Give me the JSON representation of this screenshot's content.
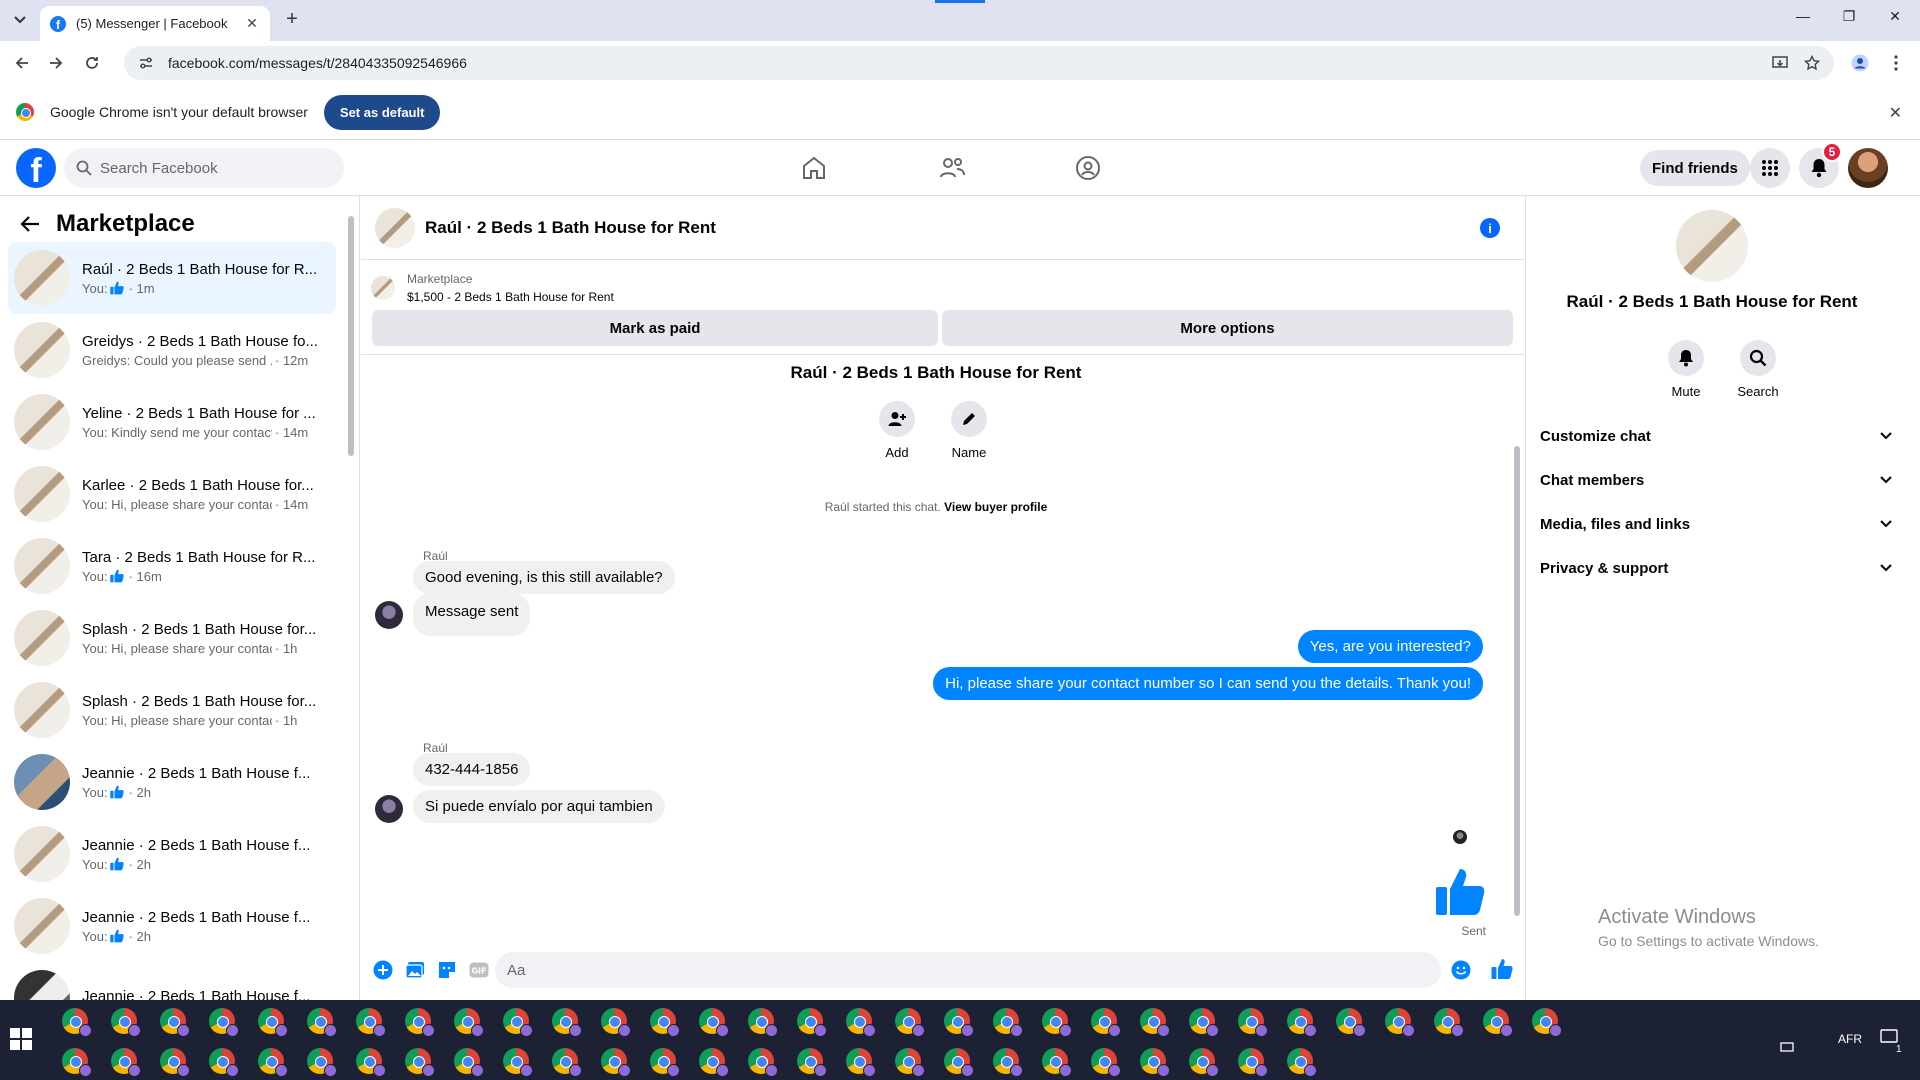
{
  "browser": {
    "tab_title": "(5) Messenger | Facebook",
    "url": "facebook.com/messages/t/28404335092546966",
    "infobar_message": "Google Chrome isn't your default browser",
    "infobar_button": "Set as default"
  },
  "facebook": {
    "search_placeholder": "Search Facebook",
    "find_friends": "Find friends",
    "notification_count": "5"
  },
  "sidebar": {
    "title": "Marketplace",
    "conversations": [
      {
        "name": "Raúl · 2 Beds 1 Bath House for R...",
        "prefix": "You:",
        "like": true,
        "preview": "",
        "time": "· 1m",
        "active": true
      },
      {
        "name": "Greidys · 2 Beds 1 Bath House fo...",
        "prefix": "",
        "like": false,
        "preview": "Greidys: Could you please send ...",
        "time": "· 12m",
        "active": false
      },
      {
        "name": "Yeline · 2 Beds 1 Bath House for ...",
        "prefix": "",
        "like": false,
        "preview": "You: Kindly send me your contact...",
        "time": "· 14m",
        "active": false
      },
      {
        "name": "Karlee · 2 Beds 1 Bath House for...",
        "prefix": "",
        "like": false,
        "preview": "You: Hi, please share your contac...",
        "time": "· 14m",
        "active": false
      },
      {
        "name": "Tara · 2 Beds 1 Bath House for R...",
        "prefix": "You:",
        "like": true,
        "preview": "",
        "time": "· 16m",
        "active": false
      },
      {
        "name": "Splash · 2 Beds 1 Bath House for...",
        "prefix": "",
        "like": false,
        "preview": "You: Hi, please share your contact ...",
        "time": "· 1h",
        "active": false
      },
      {
        "name": "Splash · 2 Beds 1 Bath House for...",
        "prefix": "",
        "like": false,
        "preview": "You: Hi, please share your contact ...",
        "time": "· 1h",
        "active": false
      },
      {
        "name": "Jeannie · 2 Beds 1 Bath House f...",
        "prefix": "You:",
        "like": true,
        "preview": "",
        "time": "· 2h",
        "active": false
      },
      {
        "name": "Jeannie · 2 Beds 1 Bath House f...",
        "prefix": "You:",
        "like": true,
        "preview": "",
        "time": "· 2h",
        "active": false
      },
      {
        "name": "Jeannie · 2 Beds 1 Bath House f...",
        "prefix": "You:",
        "like": true,
        "preview": "",
        "time": "· 2h",
        "active": false
      },
      {
        "name": "Jeannie · 2 Beds 1 Bath House f...",
        "prefix": "",
        "like": false,
        "preview": "",
        "time": "",
        "active": false
      }
    ]
  },
  "chat": {
    "title": "Raúl · 2 Beds 1 Bath House for Rent",
    "listing_source": "Marketplace",
    "listing_line": "$1,500 - 2 Beds 1 Bath House for Rent",
    "mark_paid": "Mark as paid",
    "more_options": "More options",
    "thread_title": "Raúl · 2 Beds 1 Bath House for Rent",
    "add_label": "Add",
    "name_label": "Name",
    "started_text": "Raúl started this chat.",
    "buyer_profile_link": "View buyer profile",
    "sender_name": "Raúl",
    "msg1": "Good evening, is this still available?",
    "msg2": "Message sent",
    "out1": "Yes, are you interested?",
    "out2": "Hi, please share your contact number so I can send you the details. Thank you!",
    "sender_name2": "Raúl",
    "msg3": "432-444-1856",
    "msg4": "Si puede envíalo por aqui tambien",
    "sent_label": "Sent",
    "composer_placeholder": "Aa"
  },
  "right_panel": {
    "name": "Raúl · 2 Beds 1 Bath House for Rent",
    "mute": "Mute",
    "search": "Search",
    "sections": [
      "Customize chat",
      "Chat members",
      "Media, files and links",
      "Privacy & support"
    ],
    "activate_title": "Activate Windows",
    "activate_sub": "Go to Settings to activate Windows."
  },
  "taskbar": {
    "lang": "AFR",
    "notif_count": "1"
  },
  "colors": {
    "facebook_blue": "#0866ff",
    "messenger_bubble": "#0084ff",
    "active_row": "#ebf5ff",
    "badge_red": "#e41e3f"
  }
}
